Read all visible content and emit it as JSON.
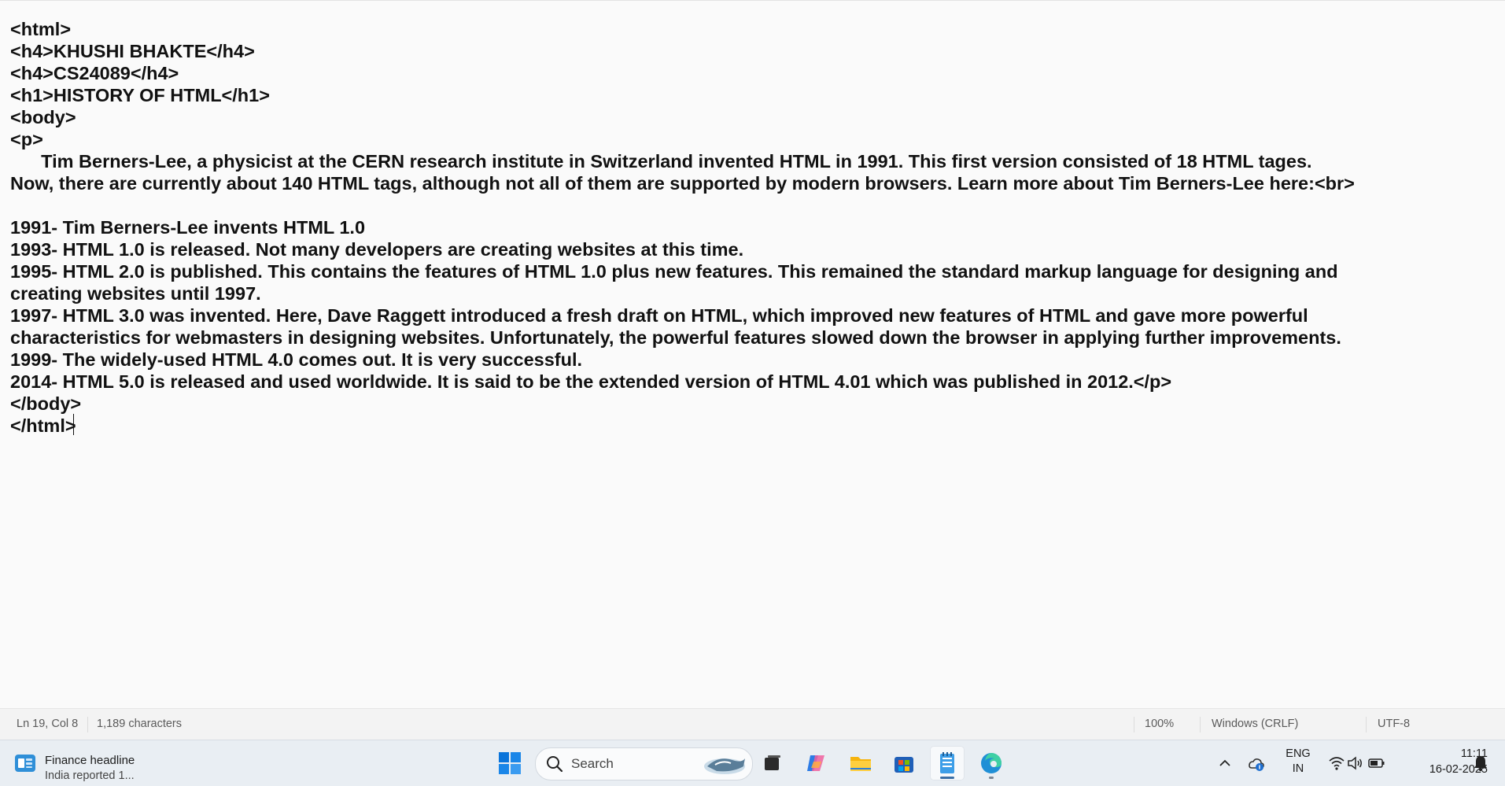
{
  "editor": {
    "lines": [
      "<html>",
      "<h4>KHUSHI BHAKTE</h4>",
      "<h4>CS24089</h4>",
      "<h1>HISTORY OF HTML</h1>",
      "<body>",
      "<p>",
      "      Tim Berners-Lee, a physicist at the CERN research institute in Switzerland invented HTML in 1991. This first version consisted of 18 HTML tages.",
      "Now, there are currently about 140 HTML tags, although not all of them are supported by modern browsers. Learn more about Tim Berners-Lee here:<br>",
      "",
      "1991- Tim Berners-Lee invents HTML 1.0",
      "1993- HTML 1.0 is released. Not many developers are creating websites at this time.",
      "1995- HTML 2.0 is published. This contains the features of HTML 1.0 plus new features. This remained the standard markup language for designing and",
      "creating websites until 1997.",
      "1997- HTML 3.0 was invented. Here, Dave Raggett introduced a fresh draft on HTML, which improved new features of HTML and gave more powerful",
      "characteristics for webmasters in designing websites. Unfortunately, the powerful features slowed down the browser in applying further improvements.",
      "1999- The widely-used HTML 4.0 comes out. It is very successful.",
      "2014- HTML 5.0 is released and used worldwide. It is said to be the extended version of HTML 4.01 which was published in 2012.</p>",
      "</body>",
      "</html>"
    ]
  },
  "status_bar": {
    "position": "Ln 19, Col 8",
    "characters": "1,189 characters",
    "zoom": "100%",
    "line_ending": "Windows (CRLF)",
    "encoding": "UTF-8"
  },
  "taskbar": {
    "widget": {
      "title": "Finance headline",
      "subtitle": "India reported 1...",
      "icon": "news-widget-icon"
    },
    "search_label": "Search",
    "apps": [
      {
        "name": "start-button",
        "icon": "windows-logo-icon"
      },
      {
        "name": "task-view-button",
        "icon": "task-view-icon"
      },
      {
        "name": "copilot-button",
        "icon": "copilot-icon"
      },
      {
        "name": "file-explorer-button",
        "icon": "folder-icon"
      },
      {
        "name": "microsoft-store-button",
        "icon": "store-icon"
      },
      {
        "name": "notepad-button",
        "icon": "notepad-icon",
        "active": true
      },
      {
        "name": "edge-button",
        "icon": "edge-icon"
      }
    ],
    "tray": {
      "language": "ENG",
      "region": "IN",
      "time": "11:11",
      "date": "16-02-2025"
    }
  },
  "colors": {
    "editor_bg": "#fafafa",
    "text": "#111111",
    "taskbar_bg": "#e9eef3",
    "accent": "#3a6ea5"
  }
}
